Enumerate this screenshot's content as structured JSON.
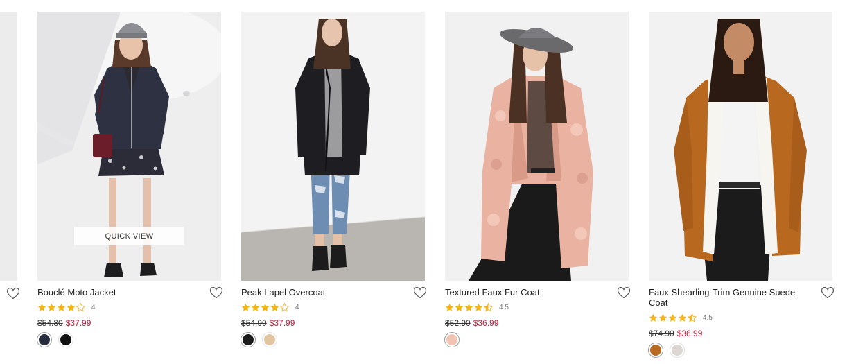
{
  "quick_view_label": "QUICK VIEW",
  "accent_sale_color": "#c41e3a",
  "star_color": "#f3b31a",
  "products": [
    {
      "name": "Bouclé Moto Jacket",
      "rating": 4,
      "rating_label": "4",
      "original_price": "$54.80",
      "sale_price": "$37.99",
      "image": "model wearing navy boucle moto jacket, grey beanie, floral dress, burgundy bag",
      "swatches": [
        {
          "color": "#262b3d",
          "selected": true
        },
        {
          "color": "#111111",
          "selected": false
        }
      ]
    },
    {
      "name": "Peak Lapel Overcoat",
      "rating": 4,
      "rating_label": "4",
      "original_price": "$54.90",
      "sale_price": "$37.99",
      "image": "model wearing black overcoat, grey tee, ripped jeans, ankle boots",
      "swatches": [
        {
          "color": "#1c1c1c",
          "selected": true
        },
        {
          "color": "#e2c4a0",
          "selected": false
        }
      ]
    },
    {
      "name": "Textured Faux Fur Coat",
      "rating": 4.5,
      "rating_label": "4.5",
      "original_price": "$52.90",
      "sale_price": "$36.99",
      "image": "model wearing pink faux fur coat, grey felt hat, black pants",
      "swatches": [
        {
          "color": "#f1c3b3",
          "selected": true
        }
      ]
    },
    {
      "name": "Faux Shearling-Trim Genuine Suede Coat",
      "rating": 4.5,
      "rating_label": "4.5",
      "original_price": "$74.90",
      "sale_price": "$36.99",
      "image": "model wearing tan suede coat with white shearling trim",
      "swatches": [
        {
          "color": "#b86a22",
          "selected": true
        },
        {
          "color": "#dcd7d2",
          "selected": false
        }
      ]
    }
  ]
}
